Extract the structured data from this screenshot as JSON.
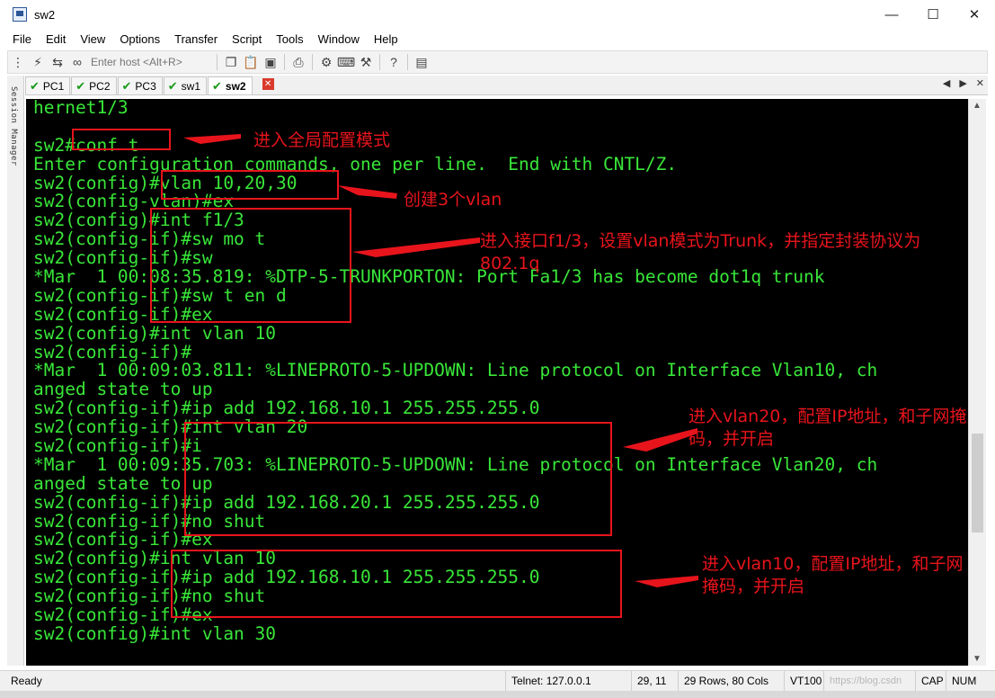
{
  "window": {
    "title": "sw2"
  },
  "menu": [
    "File",
    "Edit",
    "View",
    "Options",
    "Transfer",
    "Script",
    "Tools",
    "Window",
    "Help"
  ],
  "toolbar": {
    "host_placeholder": "Enter host <Alt+R>"
  },
  "side_panel_label": "Session Manager",
  "tabs": [
    {
      "label": "PC1",
      "active": false
    },
    {
      "label": "PC2",
      "active": false
    },
    {
      "label": "PC3",
      "active": false
    },
    {
      "label": "sw1",
      "active": false
    },
    {
      "label": "sw2",
      "active": true
    }
  ],
  "terminal": {
    "lines": [
      "hernet1/3",
      "",
      "sw2#conf t",
      "Enter configuration commands, one per line.  End with CNTL/Z.",
      "sw2(config)#vlan 10,20,30",
      "sw2(config-vlan)#ex",
      "sw2(config)#int f1/3",
      "sw2(config-if)#sw mo t",
      "sw2(config-if)#sw",
      "*Mar  1 00:08:35.819: %DTP-5-TRUNKPORTON: Port Fa1/3 has become dot1q trunk",
      "sw2(config-if)#sw t en d",
      "sw2(config-if)#ex",
      "sw2(config)#int vlan 10",
      "sw2(config-if)#",
      "*Mar  1 00:09:03.811: %LINEPROTO-5-UPDOWN: Line protocol on Interface Vlan10, ch",
      "anged state to up",
      "sw2(config-if)#ip add 192.168.10.1 255.255.255.0",
      "sw2(config-if)#int vlan 20",
      "sw2(config-if)#i",
      "*Mar  1 00:09:35.703: %LINEPROTO-5-UPDOWN: Line protocol on Interface Vlan20, ch",
      "anged state to up",
      "sw2(config-if)#ip add 192.168.20.1 255.255.255.0",
      "sw2(config-if)#no shut",
      "sw2(config-if)#ex",
      "sw2(config)#int vlan 10",
      "sw2(config-if)#ip add 192.168.10.1 255.255.255.0",
      "sw2(config-if)#no shut",
      "sw2(config-if)#ex",
      "sw2(config)#int vlan 30"
    ]
  },
  "annotations": [
    {
      "text": "进入全局配置模式"
    },
    {
      "text": "创建3个vlan"
    },
    {
      "text": "进入接口f1/3，设置vlan模式为Trunk，并指定封装协议为\n802.1q"
    },
    {
      "text": "进入vlan20，配置IP地址，和子网掩\n码，并开启"
    },
    {
      "text": "进入vlan10，配置IP地址，和子网\n掩码，并开启"
    }
  ],
  "status": {
    "state": "Ready",
    "connection": "Telnet: 127.0.0.1",
    "cursor": "29,  11",
    "size": "29 Rows, 80 Cols",
    "terminal_type": "VT100",
    "caps": "CAP",
    "num": "NUM",
    "watermark": "https://blog.csdn"
  },
  "colors": {
    "terminal_bg": "#000000",
    "terminal_fg": "#39e639",
    "annotation": "#e8141c"
  }
}
